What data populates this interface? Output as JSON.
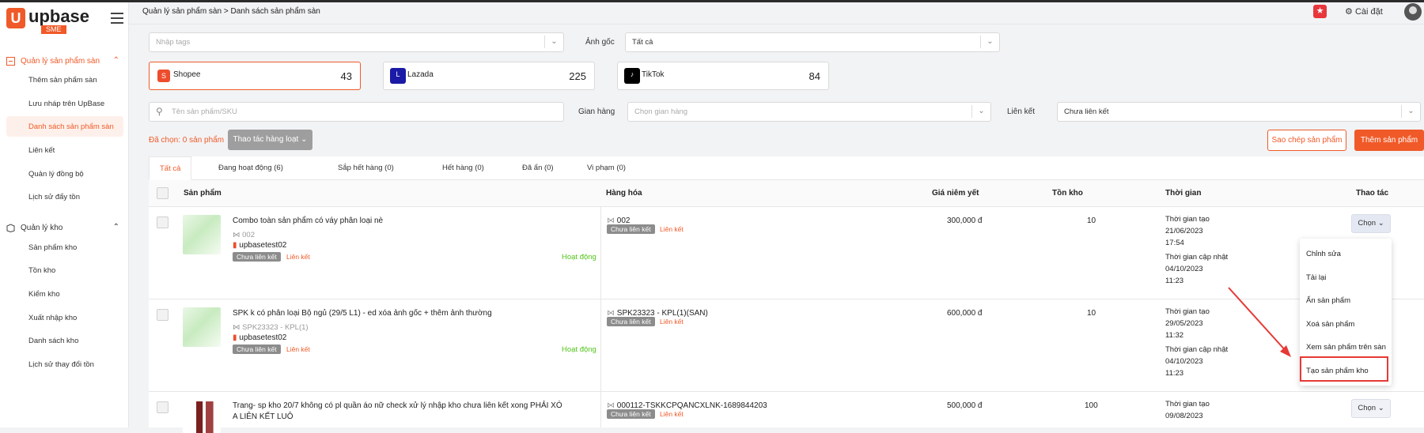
{
  "app": {
    "logo_text": "upbase",
    "logo_sub": "SME"
  },
  "breadcrumb": {
    "parent": "Quản lý sản phẩm sàn",
    "sep": ">",
    "current": "Danh sách sản phẩm sàn"
  },
  "header": {
    "settings_label": "Cài đặt"
  },
  "sidebar": {
    "group1": {
      "label": "Quản lý sản phẩm sàn",
      "items": [
        "Thêm sản phẩm sàn",
        "Lưu nháp trên UpBase",
        "Danh sách sản phẩm sàn",
        "Liên kết",
        "Quản lý đồng bộ",
        "Lịch sử đẩy tồn"
      ]
    },
    "group2": {
      "label": "Quản lý kho",
      "items": [
        "Sản phẩm kho",
        "Tồn kho",
        "Kiểm kho",
        "Xuất nhập kho",
        "Danh sách kho",
        "Lịch sử thay đổi tồn"
      ]
    }
  },
  "filters": {
    "tags_placeholder": "Nhập tags",
    "anh_goc_label": "Ảnh gốc",
    "anh_goc_value": "Tất cả",
    "search_placeholder": "Tên sản phẩm/SKU",
    "gian_hang_label": "Gian hàng",
    "gian_hang_placeholder": "Chọn gian hàng",
    "lien_ket_label": "Liên kết",
    "lien_ket_value": "Chưa liên kết"
  },
  "channels": [
    {
      "name": "Shopee",
      "count": "43",
      "color": "#ee4d2d"
    },
    {
      "name": "Lazada",
      "count": "225",
      "color": "#1a1aa6"
    },
    {
      "name": "TikTok",
      "count": "84",
      "color": "#000000"
    }
  ],
  "actions": {
    "selected_text": "Đã chọn: 0 sản phẩm",
    "bulk_label": "Thao tác hàng loạt",
    "copy_label": "Sao chép sản phẩm",
    "add_label": "Thêm sản phẩm"
  },
  "tabs": [
    "Tất cả",
    "Đang hoạt động (6)",
    "Sắp hết hàng (0)",
    "Hết hàng (0)",
    "Đã ẩn (0)",
    "Vi phạm (0)"
  ],
  "table": {
    "headers": {
      "product": "Sản phẩm",
      "goods": "Hàng hóa",
      "price": "Giá niêm yết",
      "stock": "Tồn kho",
      "time": "Thời gian",
      "actions": "Thao tác"
    },
    "rows": [
      {
        "name": "Combo toàn sản phẩm có váy phân loại nè",
        "sku": "002",
        "shop": "upbasetest02",
        "tag": "Chưa liên kết",
        "link": "Liên kết",
        "status": "Hoạt động",
        "goods_sku": "002",
        "goods_tag": "Chưa liên kết",
        "goods_link": "Liên kết",
        "price": "300,000 đ",
        "stock": "10",
        "created_label": "Thời gian tạo",
        "created_date": "21/06/2023",
        "created_time": "17:54",
        "updated_label": "Thời gian cập nhật",
        "updated_date": "04/10/2023",
        "updated_time": "11:23",
        "action": "Chọn"
      },
      {
        "name": "SPK k có phân loại Bộ ngủ (29/5 L1) - ed xóa ảnh gốc + thêm ảnh thường",
        "sku": "SPK23323 - KPL(1)",
        "shop": "upbasetest02",
        "tag": "Chưa liên kết",
        "link": "Liên kết",
        "status": "Hoạt động",
        "goods_sku": "SPK23323 - KPL(1)(SAN)",
        "goods_tag": "Chưa liên kết",
        "goods_link": "Liên kết",
        "price": "600,000 đ",
        "stock": "10",
        "created_label": "Thời gian tạo",
        "created_date": "29/05/2023",
        "created_time": "11:32",
        "updated_label": "Thời gian cập nhật",
        "updated_date": "04/10/2023",
        "updated_time": "11:23"
      },
      {
        "name": "Trang- sp kho 20/7 không có pl quần áo nữ check xử lý nhập kho chưa liên kết xong PHẢI XÓ",
        "name2": "A LIÊN KẾT LUÔ",
        "goods_sku": "000112-TSKKCPQANCXLNK-1689844203",
        "goods_tag": "Chưa liên kết",
        "goods_link": "Liên kết",
        "price": "500,000 đ",
        "stock": "100",
        "created_label": "Thời gian tạo",
        "created_date": "09/08/2023",
        "action": "Chọn"
      }
    ]
  },
  "dropdown_menu": [
    "Chỉnh sửa",
    "Tải lại",
    "Ẩn sản phẩm",
    "Xoá sản phẩm",
    "Xem sản phẩm trên sàn",
    "Tạo sản phẩm kho"
  ],
  "colors": {
    "accent": "#f05a28",
    "active_green": "#52c41a",
    "highlight_red": "#e53935"
  }
}
